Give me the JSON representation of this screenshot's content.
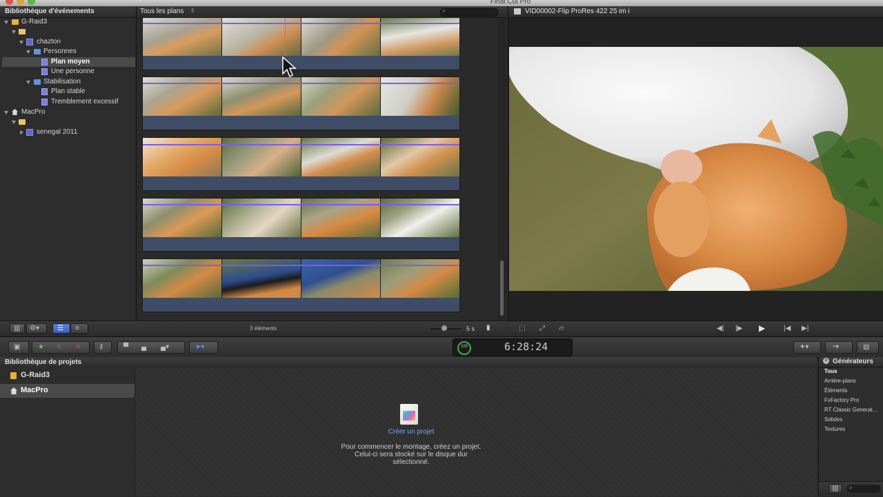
{
  "window": {
    "title": "Final Cut Pro"
  },
  "event_library": {
    "header": "Bibliothèque d'événements",
    "items": [
      {
        "label": "G-Raid3",
        "icon": "drive-icon"
      },
      {
        "label": "",
        "icon": "folder-icon"
      },
      {
        "label": "chazton",
        "icon": "event-icon"
      },
      {
        "label": "Personnes",
        "icon": "smart-folder-icon"
      },
      {
        "label": "Plan moyen",
        "icon": "keyword-icon",
        "selected": true
      },
      {
        "label": "Une personne",
        "icon": "keyword-icon"
      },
      {
        "label": "Stabilisation",
        "icon": "smart-folder-icon"
      },
      {
        "label": "Plan stable",
        "icon": "keyword-icon"
      },
      {
        "label": "Tremblement excessif",
        "icon": "keyword-icon"
      },
      {
        "label": "MacPro",
        "icon": "home-icon"
      },
      {
        "label": "",
        "icon": "folder-icon"
      },
      {
        "label": "senegal 2011",
        "icon": "event-icon"
      }
    ]
  },
  "browser": {
    "filter": "Tous les plans",
    "item_count": "3 éléments",
    "zoom_label": "5 s"
  },
  "viewer": {
    "clip_title": "VID00002-Flip ProRes 422 25 im i"
  },
  "toolbar": {
    "timecode": "6:28:24",
    "zoom_percent": "100"
  },
  "project_library": {
    "header": "Bibliothèque de projets",
    "items": [
      {
        "label": "G-Raid3",
        "icon": "drive-icon"
      },
      {
        "label": "MacPro",
        "icon": "home-icon",
        "selected": true
      }
    ],
    "create_label": "Créer un projet",
    "empty_line1": "Pour commencer le montage, créez un projet.",
    "empty_line2": "Celui-ci sera stocké sur le disque dur",
    "empty_line3": "sélectionné."
  },
  "generators": {
    "header": "Générateurs",
    "items": [
      "Tous",
      "Arrière-plans",
      "Éléments",
      "FxFactory Pro",
      "RT Classic Generat...",
      "Solides",
      "Textures"
    ]
  },
  "colors": {
    "selection_purple": "#7a5cf0",
    "link_blue": "#6fa8ff",
    "audio_blue": "#3f4c66"
  }
}
